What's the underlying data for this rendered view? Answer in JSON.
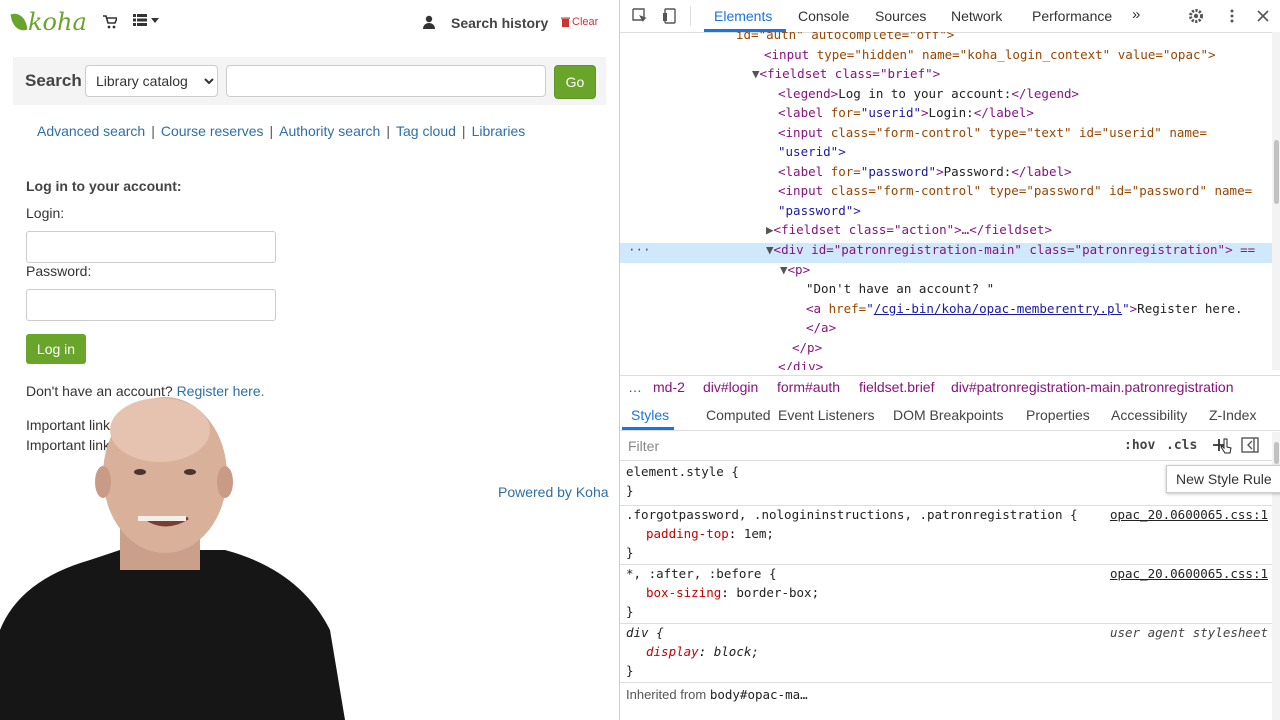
{
  "opac": {
    "logo": "koha",
    "header": {
      "search_history": "Search history",
      "clear": "Clear"
    },
    "search": {
      "label": "Search",
      "scope": "Library catalog",
      "go": "Go"
    },
    "nav_links": [
      "Advanced search",
      "Course reserves",
      "Authority search",
      "Tag cloud",
      "Libraries"
    ],
    "login": {
      "legend": "Log in to your account:",
      "login_label": "Login:",
      "password_label": "Password:",
      "button": "Log in",
      "no_account": "Don't have an account?",
      "register": "Register here.",
      "important_1": "Important link",
      "important_2": "Important link"
    },
    "powered_by": "Powered by",
    "powered_brand": "Koha"
  },
  "devtools": {
    "tabs": [
      "Elements",
      "Console",
      "Sources",
      "Network",
      "Performance"
    ],
    "active_tab": "Elements",
    "dom_lines": [
      {
        "indent": 0,
        "html": "id=\"auth\" autocomplete=\"off\">"
      },
      {
        "indent": 1,
        "tag": "input",
        "attrs": [
          [
            "type",
            "hidden"
          ],
          [
            "name",
            "koha_login_context"
          ],
          [
            "value",
            "opac"
          ]
        ]
      },
      {
        "indent": 1,
        "tag": "fieldset",
        "attrs": [
          [
            "class",
            "brief"
          ]
        ],
        "open": true
      },
      {
        "indent": 2,
        "text": "legend_line"
      },
      {
        "indent": 2,
        "text": "label_userid"
      },
      {
        "indent": 2,
        "text": "input_userid"
      },
      {
        "indent": 2,
        "text": "label_password"
      },
      {
        "indent": 2,
        "text": "input_password"
      }
    ],
    "dom": {
      "l0": "id=\"auth\" autocomplete=\"off\">",
      "l1_attrs": "type=\"hidden\" name=\"koha_login_context\" value=\"opac\">",
      "l2": "fieldset class=\"brief\">",
      "l3_legend": "Log in to your account:",
      "l4_label": "Login:",
      "l5_input": "class=\"form-control\" type=\"text\" id=\"userid\" name=",
      "l5b": "\"userid\">",
      "l6_label": "Password:",
      "l7_input": "class=\"form-control\" type=\"password\" id=\"password\" name=",
      "l7b": "\"password\">",
      "l8": "fieldset class=\"action\">…</fieldset>",
      "l9": "div id=\"patronregistration-main\" class=\"patronregistration\"> ==",
      "l10": "<p>",
      "l11": "\"Don't have an account? \"",
      "l12_href": "/cgi-bin/koha/opac-memberentry.pl",
      "l12_text": "Register here.",
      "l13": "</a>",
      "l14": "</p>",
      "l15": "</div>"
    },
    "breadcrumbs": [
      "md-2",
      "div#login",
      "form#auth",
      "fieldset.brief",
      "div#patronregistration-main.patronregistration"
    ],
    "sub_tabs": [
      "Styles",
      "Computed",
      "Event Listeners",
      "DOM Breakpoints",
      "Properties",
      "Accessibility",
      "Z-Index"
    ],
    "filter_placeholder": "Filter",
    "hov": ":hov",
    "cls": ".cls",
    "tooltip": "New Style Rule",
    "styles": [
      {
        "selector": "element.style {",
        "source": "",
        "props": [],
        "close": "}"
      },
      {
        "selector": ".forgotpassword, .nologininstructions, .patronregistration {",
        "source": "opac_20.0600065.css:1",
        "props": [
          [
            "padding-top",
            "1em;"
          ]
        ],
        "close": "}"
      },
      {
        "selector": "*, :after, :before {",
        "source": "opac_20.0600065.css:1",
        "props": [
          [
            "box-sizing",
            "border-box;"
          ]
        ],
        "close": "}"
      },
      {
        "selector": "div {",
        "source": "user agent stylesheet",
        "props": [
          [
            "display",
            "block;"
          ]
        ],
        "close": "}"
      }
    ],
    "inherited_label": "Inherited from",
    "inherited_from": "body#opac-ma…"
  }
}
